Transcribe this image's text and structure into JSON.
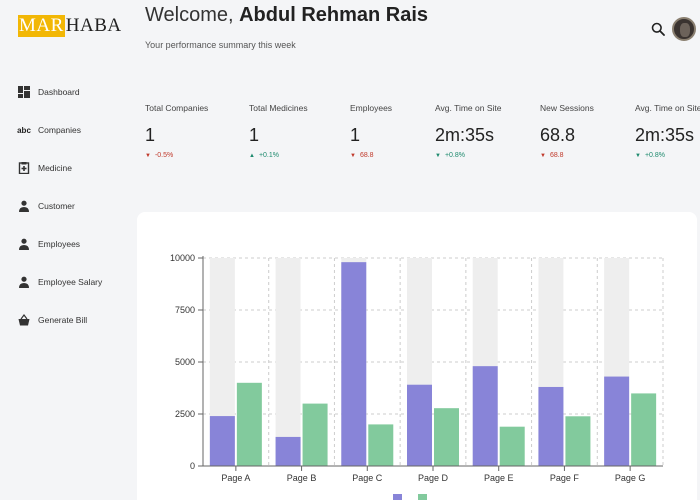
{
  "brand": {
    "logo_highlight": "MAR",
    "logo_rest": "HABA"
  },
  "sidebar": {
    "items": [
      {
        "label": "Dashboard",
        "icon": "dashboard-icon"
      },
      {
        "label": "Companies",
        "icon": "abc-icon",
        "icon_text": "abc"
      },
      {
        "label": "Medicine",
        "icon": "medicine-icon"
      },
      {
        "label": "Customer",
        "icon": "person-icon"
      },
      {
        "label": "Employees",
        "icon": "person-icon"
      },
      {
        "label": "Employee Salary",
        "icon": "person-icon"
      },
      {
        "label": "Generate Bill",
        "icon": "basket-icon"
      }
    ]
  },
  "header": {
    "welcome": "Welcome, ",
    "user_name": "Abdul Rehman Rais",
    "subtitle": "Your performance summary this week",
    "search_icon": "search-icon",
    "avatar": "avatar"
  },
  "stats": [
    {
      "label": "Total Companies",
      "value": "1",
      "change": "-0.5%",
      "direction": "down"
    },
    {
      "label": "Total Medicines",
      "value": "1",
      "change": "+0.1%",
      "direction": "up"
    },
    {
      "label": "Employees",
      "value": "1",
      "change": "68.8",
      "direction": "down"
    },
    {
      "label": "Avg. Time on Site",
      "value": "2m:35s",
      "change": "+0.8%",
      "direction": "up"
    },
    {
      "label": "New Sessions",
      "value": "68.8",
      "change": "68.8",
      "direction": "down"
    },
    {
      "label": "Avg. Time on Site",
      "value": "2m:35s",
      "change": "+0.8%",
      "direction": "up"
    }
  ],
  "colors": {
    "series_a": "#8884d8",
    "series_b": "#82ca9d",
    "background_bar": "#eeeeee",
    "down": "#c0392b",
    "up": "#1e8a6e",
    "logo_highlight": "#f2b705"
  },
  "chart_data": {
    "type": "bar",
    "categories": [
      "Page A",
      "Page B",
      "Page C",
      "Page D",
      "Page E",
      "Page F",
      "Page G"
    ],
    "series": [
      {
        "values": [
          2400,
          1398,
          9800,
          3908,
          4800,
          3800,
          4300
        ]
      },
      {
        "values": [
          4000,
          3000,
          2000,
          2780,
          1890,
          2390,
          3490
        ]
      }
    ],
    "yticks": [
      "0",
      "2500",
      "5000",
      "7500",
      "10000"
    ],
    "ylim": [
      0,
      10000
    ],
    "background_bar_value": 10000,
    "grid": true
  }
}
